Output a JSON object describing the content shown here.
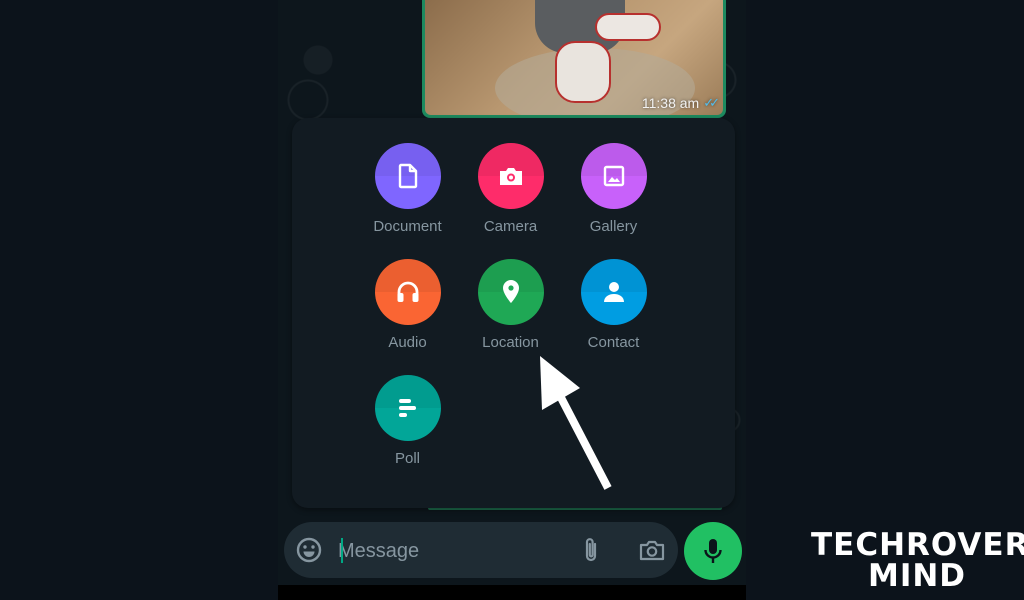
{
  "chat": {
    "image_message": {
      "timestamp": "11:38 am",
      "status_icon": "double-check-read-icon",
      "status_color": "#53bdeb"
    }
  },
  "attach_menu": {
    "options": [
      {
        "label": "Document",
        "icon": "document-icon",
        "color": "#7f66ff"
      },
      {
        "label": "Camera",
        "icon": "camera-icon",
        "color": "#fe2c6a"
      },
      {
        "label": "Gallery",
        "icon": "gallery-icon",
        "color": "#c861fa"
      },
      {
        "label": "Audio",
        "icon": "headphones-icon",
        "color": "#fa6533"
      },
      {
        "label": "Location",
        "icon": "location-pin-icon",
        "color": "#1fa855"
      },
      {
        "label": "Contact",
        "icon": "person-icon",
        "color": "#009de2"
      },
      {
        "label": "Poll",
        "icon": "poll-icon",
        "color": "#02a698"
      }
    ]
  },
  "composer": {
    "placeholder": "Message",
    "value": "",
    "emoji_icon": "emoji-icon",
    "attach_icon": "paperclip-icon",
    "camera_icon": "camera-icon",
    "mic_icon": "microphone-icon",
    "accent": "#21c063"
  },
  "annotation": {
    "arrow_target": "Location"
  },
  "watermark": {
    "line1": "TECHROVER",
    "line2": "MIND"
  }
}
